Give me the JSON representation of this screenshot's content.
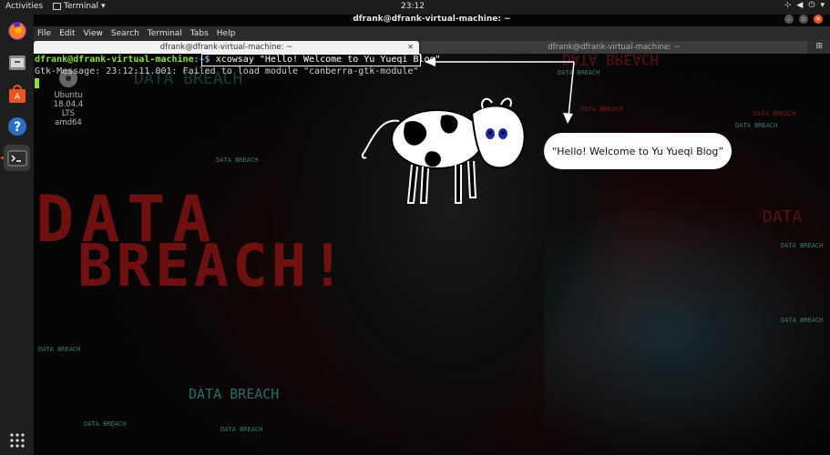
{
  "topbar": {
    "activities": "Activities",
    "app_name": "Terminal",
    "clock": "23:12"
  },
  "window": {
    "title": "dfrank@dfrank-virtual-machine: ~",
    "menu": [
      "File",
      "Edit",
      "View",
      "Search",
      "Terminal",
      "Tabs",
      "Help"
    ],
    "tabs": [
      {
        "label": "dfrank@dfrank-virtual-machine: ~",
        "active": true
      },
      {
        "label": "dfrank@dfrank-virtual-machine: ~",
        "active": false
      }
    ]
  },
  "terminal": {
    "prompt_user": "dfrank@dfrank-virtual-machine",
    "prompt_path": ":~$ ",
    "command": "xcowsay \"Hello! Welcome to Yu Yueqi Blog\"",
    "gtk_message": "Gtk-Message: 23:12:11.001: Failed to load module \"canberra-gtk-module\""
  },
  "desktop_icon": {
    "line1": "Ubuntu",
    "line2": "18.04.4 LTS",
    "line3": "amd64"
  },
  "bubble_text": "“Hello! Welcome to Yu Yueqi Blog”",
  "wallpaper": {
    "big_line1": "DATA",
    "big_line2": "BREACH!",
    "label": "DATA BREACH",
    "label_lower": "DATA BREACH"
  },
  "colors": {
    "prompt_green": "#8ae234",
    "prompt_blue": "#729fcf",
    "accent": "#e95420"
  },
  "dock": [
    "firefox-icon",
    "files-icon",
    "software-icon",
    "help-icon",
    "terminal-icon",
    "apps-grid-icon"
  ]
}
